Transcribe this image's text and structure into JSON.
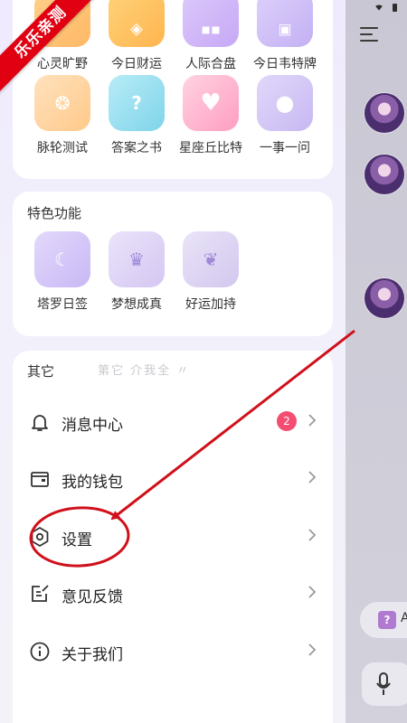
{
  "watermark": "乐乐亲测",
  "top_grid": {
    "row1": [
      {
        "label": "心灵旷野",
        "icon": "heart-field-icon",
        "color": "#ffb866"
      },
      {
        "label": "今日财运",
        "icon": "coin-icon",
        "color": "#ffb54f"
      },
      {
        "label": "人际合盘",
        "icon": "people-icon",
        "color": "#c6a8f5"
      },
      {
        "label": "今日韦特牌",
        "icon": "tarot-card-icon",
        "color": "#c3b0f4"
      }
    ],
    "row2": [
      {
        "label": "脉轮测试",
        "icon": "chakra-icon",
        "color": "#ffc98a"
      },
      {
        "label": "答案之书",
        "icon": "answer-book-icon",
        "color": "#7fd4ea"
      },
      {
        "label": "星座丘比特",
        "icon": "cupid-heart-icon",
        "color": "#ff9dc0"
      },
      {
        "label": "一事一问",
        "icon": "crystal-ball-icon",
        "color": "#c7b8f2"
      }
    ]
  },
  "features": {
    "title": "特色功能",
    "items": [
      {
        "label": "塔罗日签",
        "icon": "moon-card-icon",
        "color": "#c8b8f5"
      },
      {
        "label": "梦想成真",
        "icon": "dream-cup-icon",
        "color": "#d4c7f2"
      },
      {
        "label": "好运加持",
        "icon": "luck-leaf-icon",
        "color": "#d2c7ee"
      }
    ]
  },
  "other": {
    "title": "其它",
    "faint_text": "第它 介我全 〃",
    "items": [
      {
        "label": "消息中心",
        "icon": "bell-icon",
        "badge": "2"
      },
      {
        "label": "我的钱包",
        "icon": "wallet-icon"
      },
      {
        "label": "设置",
        "icon": "settings-icon"
      },
      {
        "label": "意见反馈",
        "icon": "feedback-icon"
      },
      {
        "label": "关于我们",
        "icon": "info-icon"
      }
    ]
  },
  "background_chat": {
    "chip_letter": "A",
    "chip_icon_text": "?"
  },
  "colors": {
    "badge": "#f34d72",
    "annotation_red": "#d0101a"
  }
}
